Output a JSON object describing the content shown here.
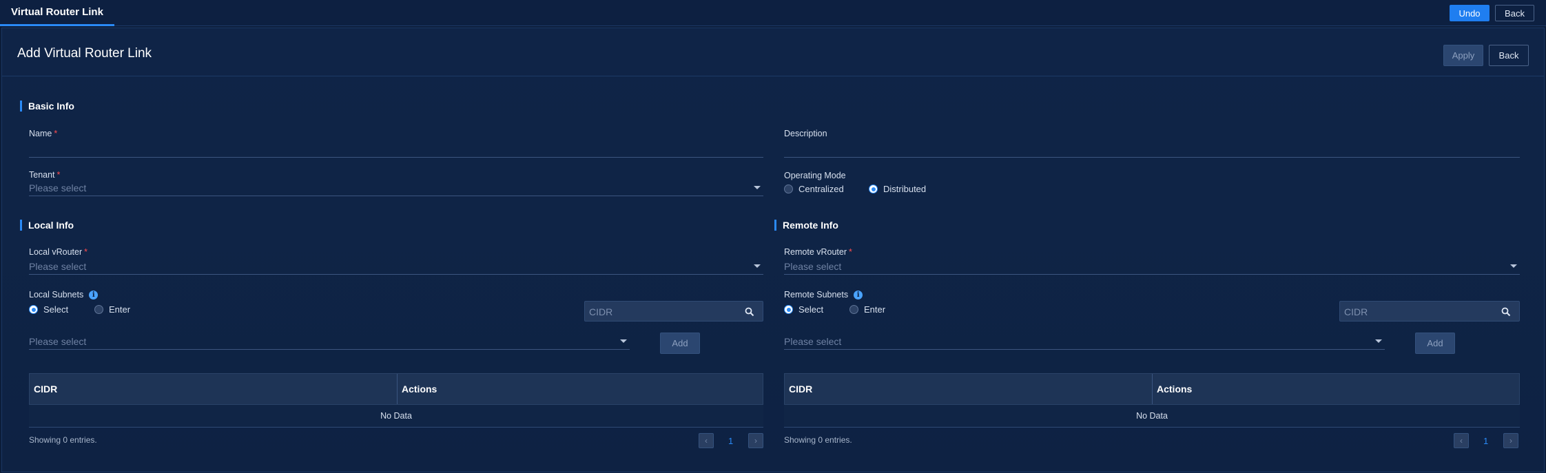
{
  "topbar": {
    "tab_label": "Virtual Router Link",
    "undo_label": "Undo",
    "back_label": "Back"
  },
  "header": {
    "title": "Add Virtual Router Link",
    "apply_label": "Apply",
    "back_label": "Back"
  },
  "basic_info": {
    "section_title": "Basic Info",
    "name_label": "Name",
    "required_mark": "*",
    "description_label": "Description",
    "tenant_label": "Tenant",
    "tenant_placeholder": "Please select",
    "operating_mode_label": "Operating Mode",
    "mode_options": [
      "Centralized",
      "Distributed"
    ],
    "mode_selected": "Distributed"
  },
  "local_info": {
    "section_title": "Local Info",
    "vrouter_label": "Local vRouter",
    "vrouter_placeholder": "Please select",
    "subnets_label": "Local Subnets",
    "info_glyph": "i",
    "radio_select": "Select",
    "radio_enter": "Enter",
    "cidr_placeholder": "CIDR",
    "subnet_placeholder": "Please select",
    "add_label": "Add",
    "table_headers": [
      "CIDR",
      "Actions"
    ],
    "no_data": "No Data",
    "showing": "Showing 0 entries.",
    "page": "1"
  },
  "remote_info": {
    "section_title": "Remote Info",
    "vrouter_label": "Remote vRouter",
    "vrouter_placeholder": "Please select",
    "subnets_label": "Remote Subnets",
    "info_glyph": "i",
    "radio_select": "Select",
    "radio_enter": "Enter",
    "cidr_placeholder": "CIDR",
    "subnet_placeholder": "Please select",
    "add_label": "Add",
    "table_headers": [
      "CIDR",
      "Actions"
    ],
    "no_data": "No Data",
    "showing": "Showing 0 entries.",
    "page": "1"
  },
  "pager": {
    "prev_glyph": "‹",
    "next_glyph": "›"
  },
  "colors": {
    "background": "#0c1d3a",
    "accent": "#2a8af6",
    "primary_button": "#1f7ef0",
    "required": "#ff4d4f"
  }
}
